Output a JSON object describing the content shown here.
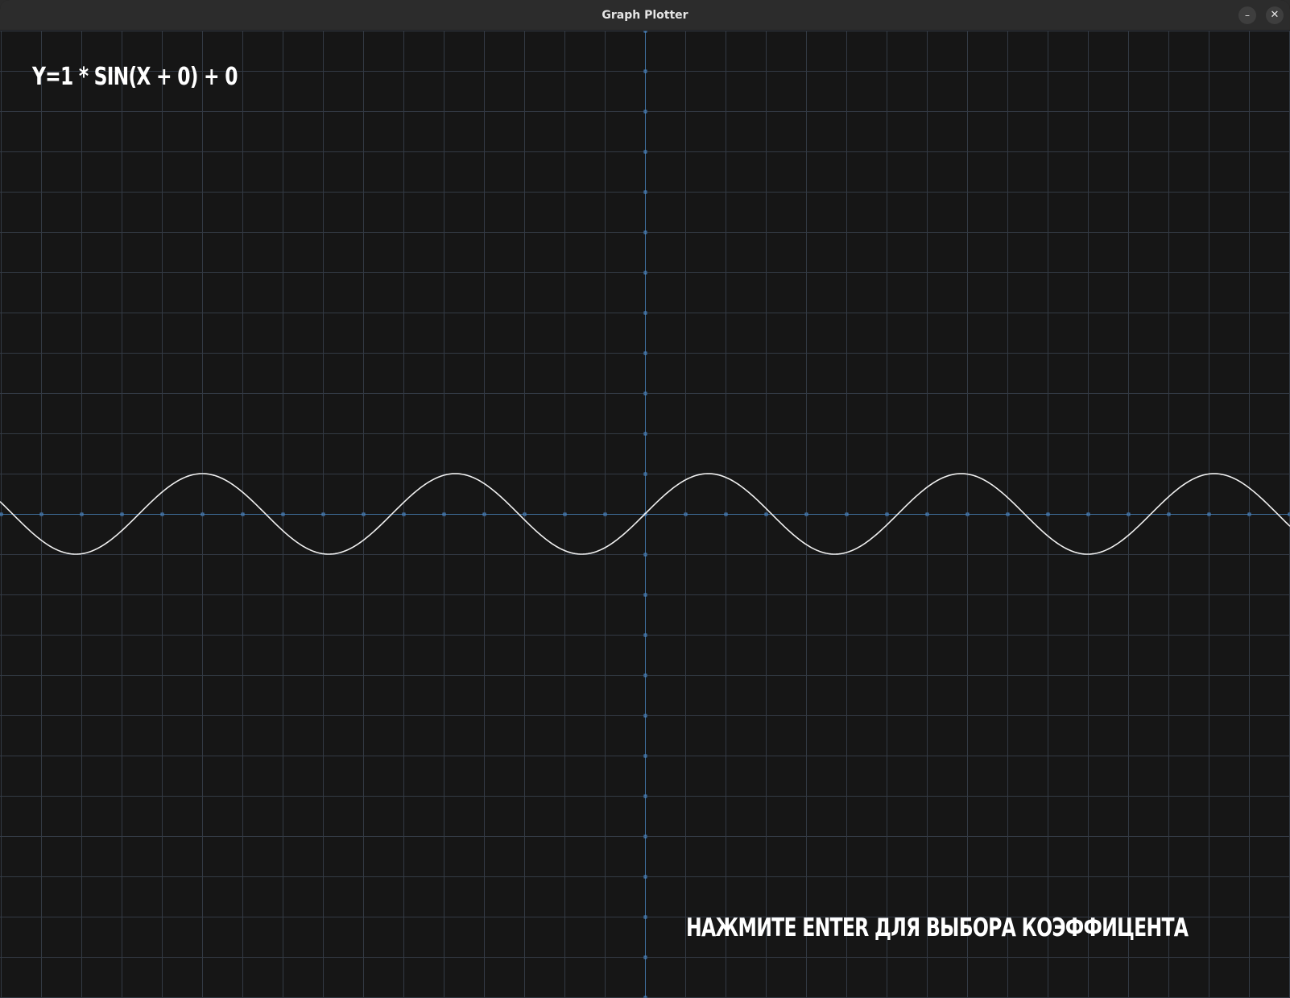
{
  "window": {
    "title": "Graph Plotter",
    "minimize_glyph": "–",
    "close_glyph": "✕"
  },
  "plot": {
    "equation": "Y=1 * SIN(X + 0) + 0",
    "hint": "НАЖМИТЕ ENTER ДЛЯ ВЫБОРА КОЭФФИЦЕНТА"
  },
  "chart_data": {
    "type": "line",
    "function": "y = 1 * sin(x + 0) + 0",
    "amplitude": 1,
    "phase": 0,
    "offset": 0,
    "grid": true,
    "colors": {
      "background": "#161616",
      "grid": "#333a44",
      "axis": "#3f6f9c",
      "tick": "#4a86c5",
      "curve": "#f0f0f0"
    }
  }
}
